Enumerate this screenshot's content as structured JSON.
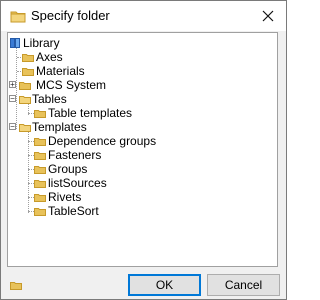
{
  "window": {
    "title": "Specify folder"
  },
  "tree": {
    "root": "Library",
    "nodes": [
      {
        "label": "Axes"
      },
      {
        "label": "Materials"
      },
      {
        "label": "MCS System"
      },
      {
        "label": "Tables"
      },
      {
        "label": "Table templates"
      },
      {
        "label": "Templates"
      },
      {
        "label": "Dependence groups"
      },
      {
        "label": "Fasteners"
      },
      {
        "label": "Groups"
      },
      {
        "label": "listSources"
      },
      {
        "label": "Rivets"
      },
      {
        "label": "TableSort"
      }
    ]
  },
  "buttons": {
    "ok": "OK",
    "cancel": "Cancel"
  },
  "colors": {
    "folder": "#e8c25a",
    "folder_edge": "#c79a2a",
    "accent": "#0078d7"
  }
}
